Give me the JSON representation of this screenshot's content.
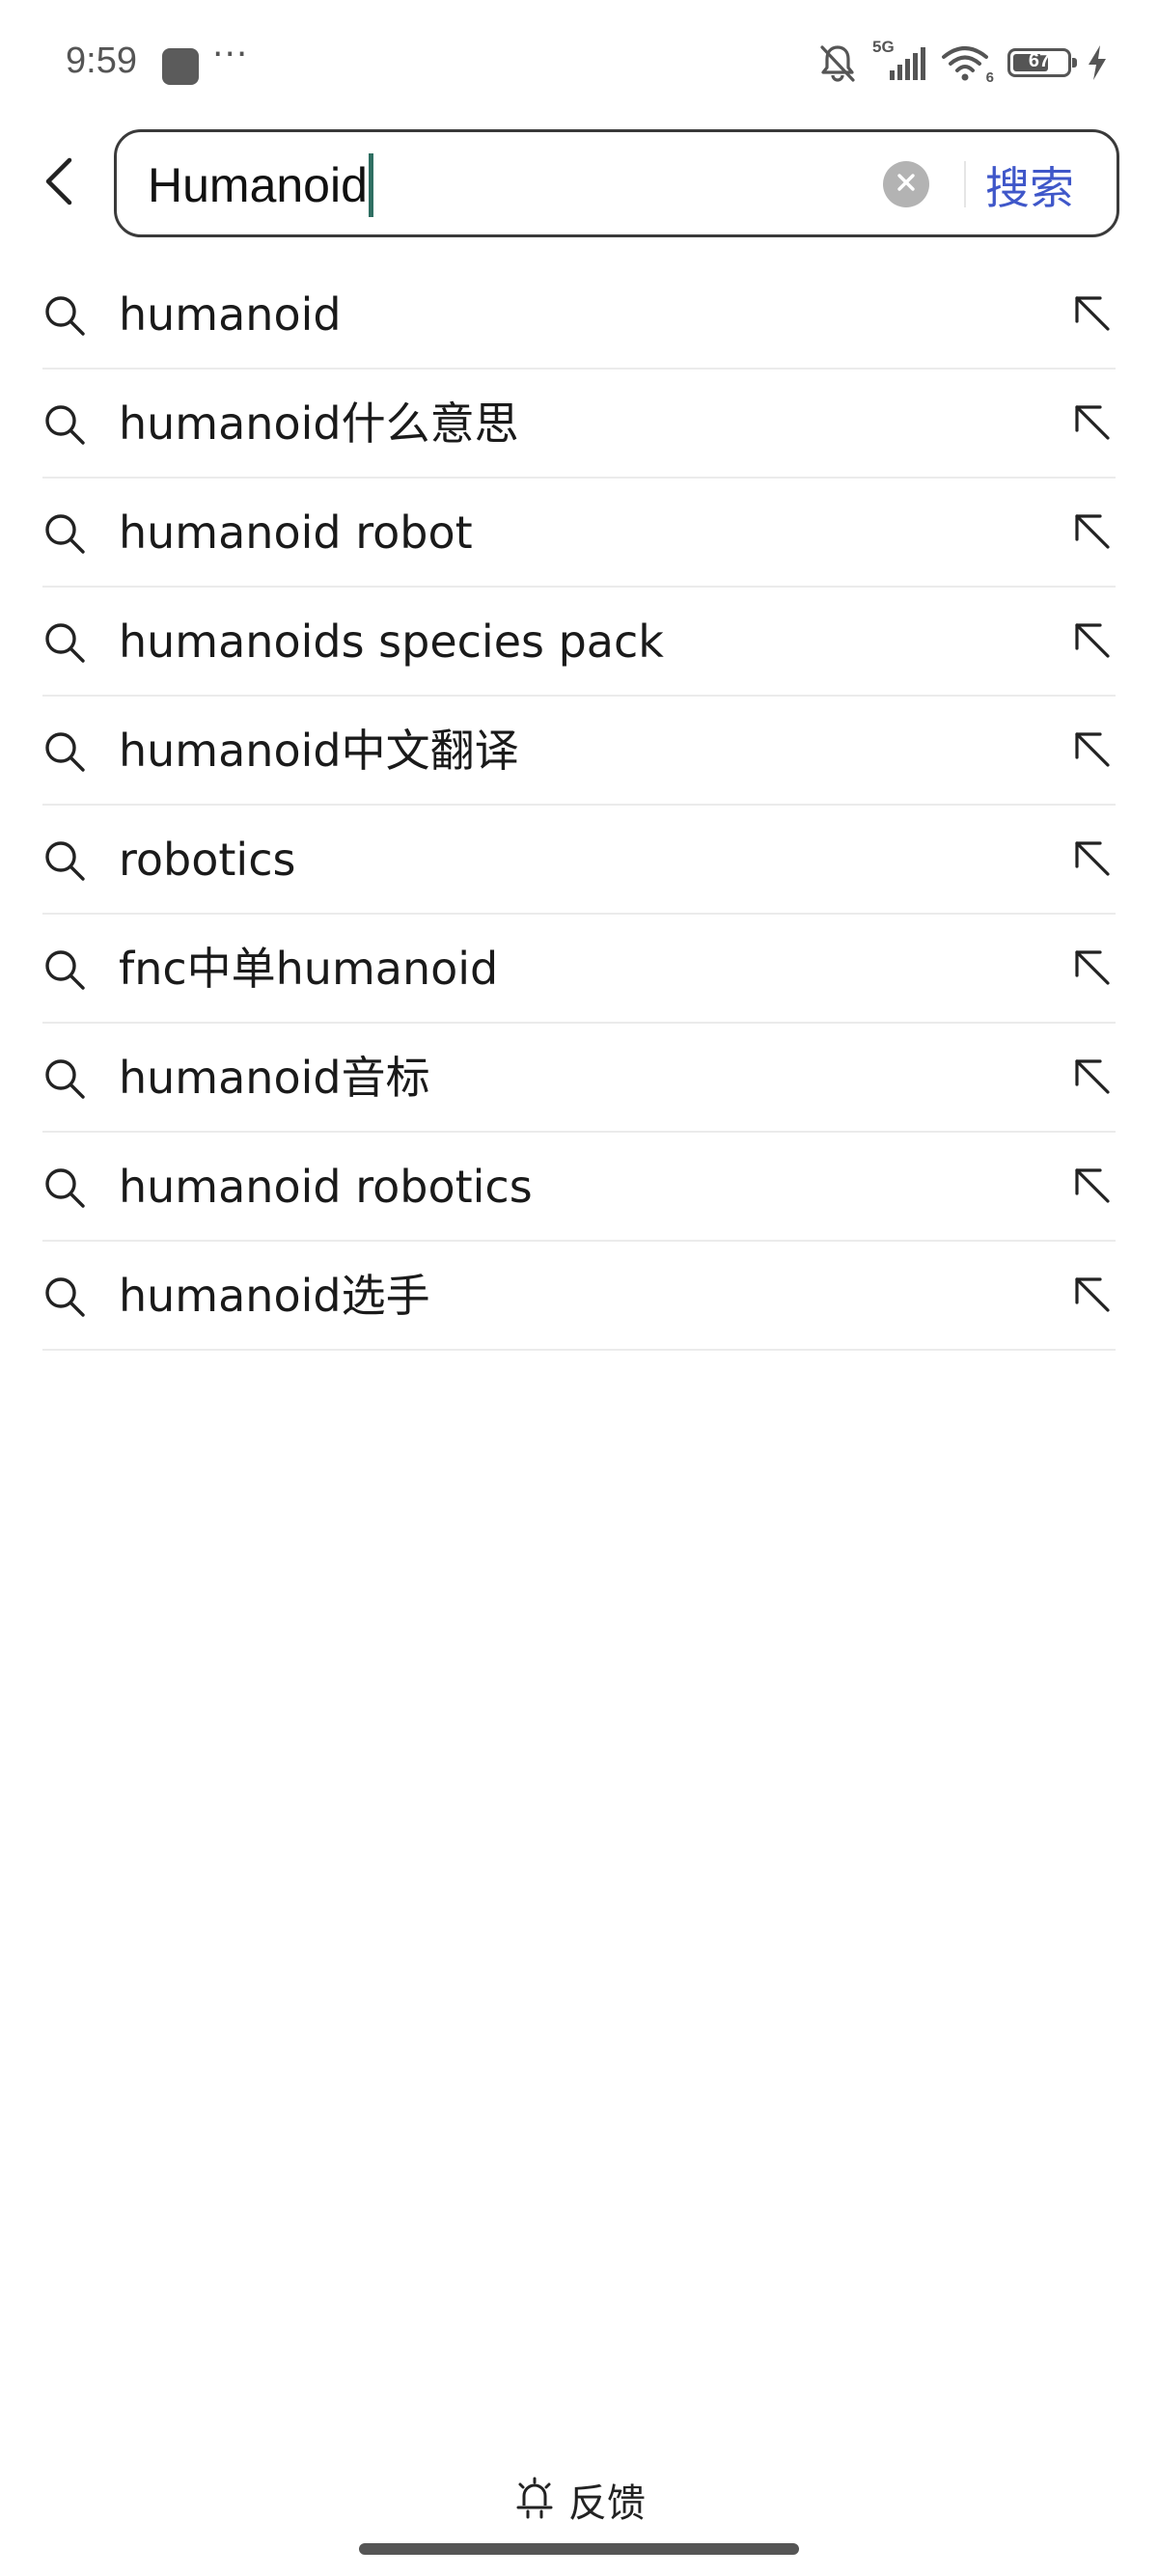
{
  "status_bar": {
    "time": "9:59",
    "more": "···",
    "network": "5G",
    "wifi_sub": "6",
    "battery": "67",
    "battery_level": 0.67
  },
  "search": {
    "query": "Humanoid",
    "submit_label": "搜索"
  },
  "suggestions": [
    {
      "text": "humanoid"
    },
    {
      "text": "humanoid什么意思"
    },
    {
      "text": "humanoid robot"
    },
    {
      "text": "humanoids species pack"
    },
    {
      "text": "humanoid中文翻译"
    },
    {
      "text": "robotics"
    },
    {
      "text": "fnc中单humanoid"
    },
    {
      "text": "humanoid音标"
    },
    {
      "text": "humanoid robotics"
    },
    {
      "text": "humanoid选手"
    }
  ],
  "footer": {
    "feedback_label": "反馈"
  },
  "colors": {
    "accent": "#3f57c9",
    "caret": "#2f6f62",
    "text": "#1a1a1a",
    "divider": "#ebebeb"
  }
}
